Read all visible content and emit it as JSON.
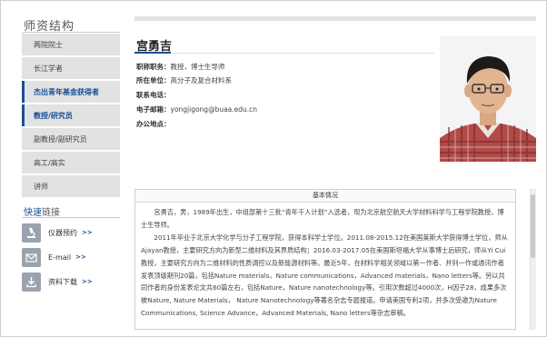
{
  "sidebar": {
    "title": "师资结构",
    "items": [
      {
        "label": "两院院士",
        "active": false
      },
      {
        "label": "长江学者",
        "active": false
      },
      {
        "label": "杰出青年基金获得者",
        "active": true
      },
      {
        "label": "教授/研究员",
        "active": true
      },
      {
        "label": "副教授/副研究员",
        "active": false
      },
      {
        "label": "高工/高实",
        "active": false
      },
      {
        "label": "讲师",
        "active": false
      }
    ]
  },
  "quick_links": {
    "title_prefix": "快速",
    "title_suffix": "链接",
    "items": [
      {
        "label": "仪器预约",
        "arrow": ">>",
        "icon": "microscope-icon"
      },
      {
        "label": "E-mail",
        "arrow": ">>",
        "icon": "envelope-icon"
      },
      {
        "label": "资料下载",
        "arrow": ">>",
        "icon": "download-icon"
      }
    ]
  },
  "profile": {
    "name": "宫勇吉",
    "fields": [
      {
        "key": "职称职务：",
        "value": "教授，博士生导师"
      },
      {
        "key": "所在单位：",
        "value": "高分子及复合材料系"
      },
      {
        "key": "联系电话：",
        "value": ""
      },
      {
        "key": "电子邮箱：",
        "value": "yongjigong@buaa.edu.cn"
      },
      {
        "key": "办公地点：",
        "value": ""
      }
    ]
  },
  "bio": {
    "header": "基本情况",
    "paragraphs": [
      "宫勇吉，男，1989年出生，中组部第十三批“青年千人计划”入选者，现为北京航空航天大学材料科学与工程学院教授，博士生导师。",
      "2011年毕业于北京大学化学与分子工程学院，获得本科学士学位。2011.08-2015.12在美国莱斯大学获得博士学位，师从Ajayan教授，主要研究方向为新型二维材料及其界质结构；2016.03-2017.05在美国斯坦福大学从事博士后研究，师从Yi Cui教授，主要研究方向为二维材料的性质调控以及新能源材料等。最近5年，在材料学相关领域以第一作者、并列一作或通讯作者发表顶级期刊20篇，包括Nature materials，Nature communications，Advanced materials，Nano letters等。另以共同作者的身份发表论文共60篇左右，包括Nature，Nature nanotechnology等。引用次数超过4000次，H因子28，成果多次被Nature, Nature Materials， Nature Nanotechnology等著名杂志专题报道。申请美国专利2项，并多次受邀为Nature Communications, Science Advance，Advanced Materials, Nano letters等杂志审稿。"
    ]
  },
  "colors": {
    "accent": "#1a4f96",
    "sidebar_bg": "#e2e2e2"
  }
}
